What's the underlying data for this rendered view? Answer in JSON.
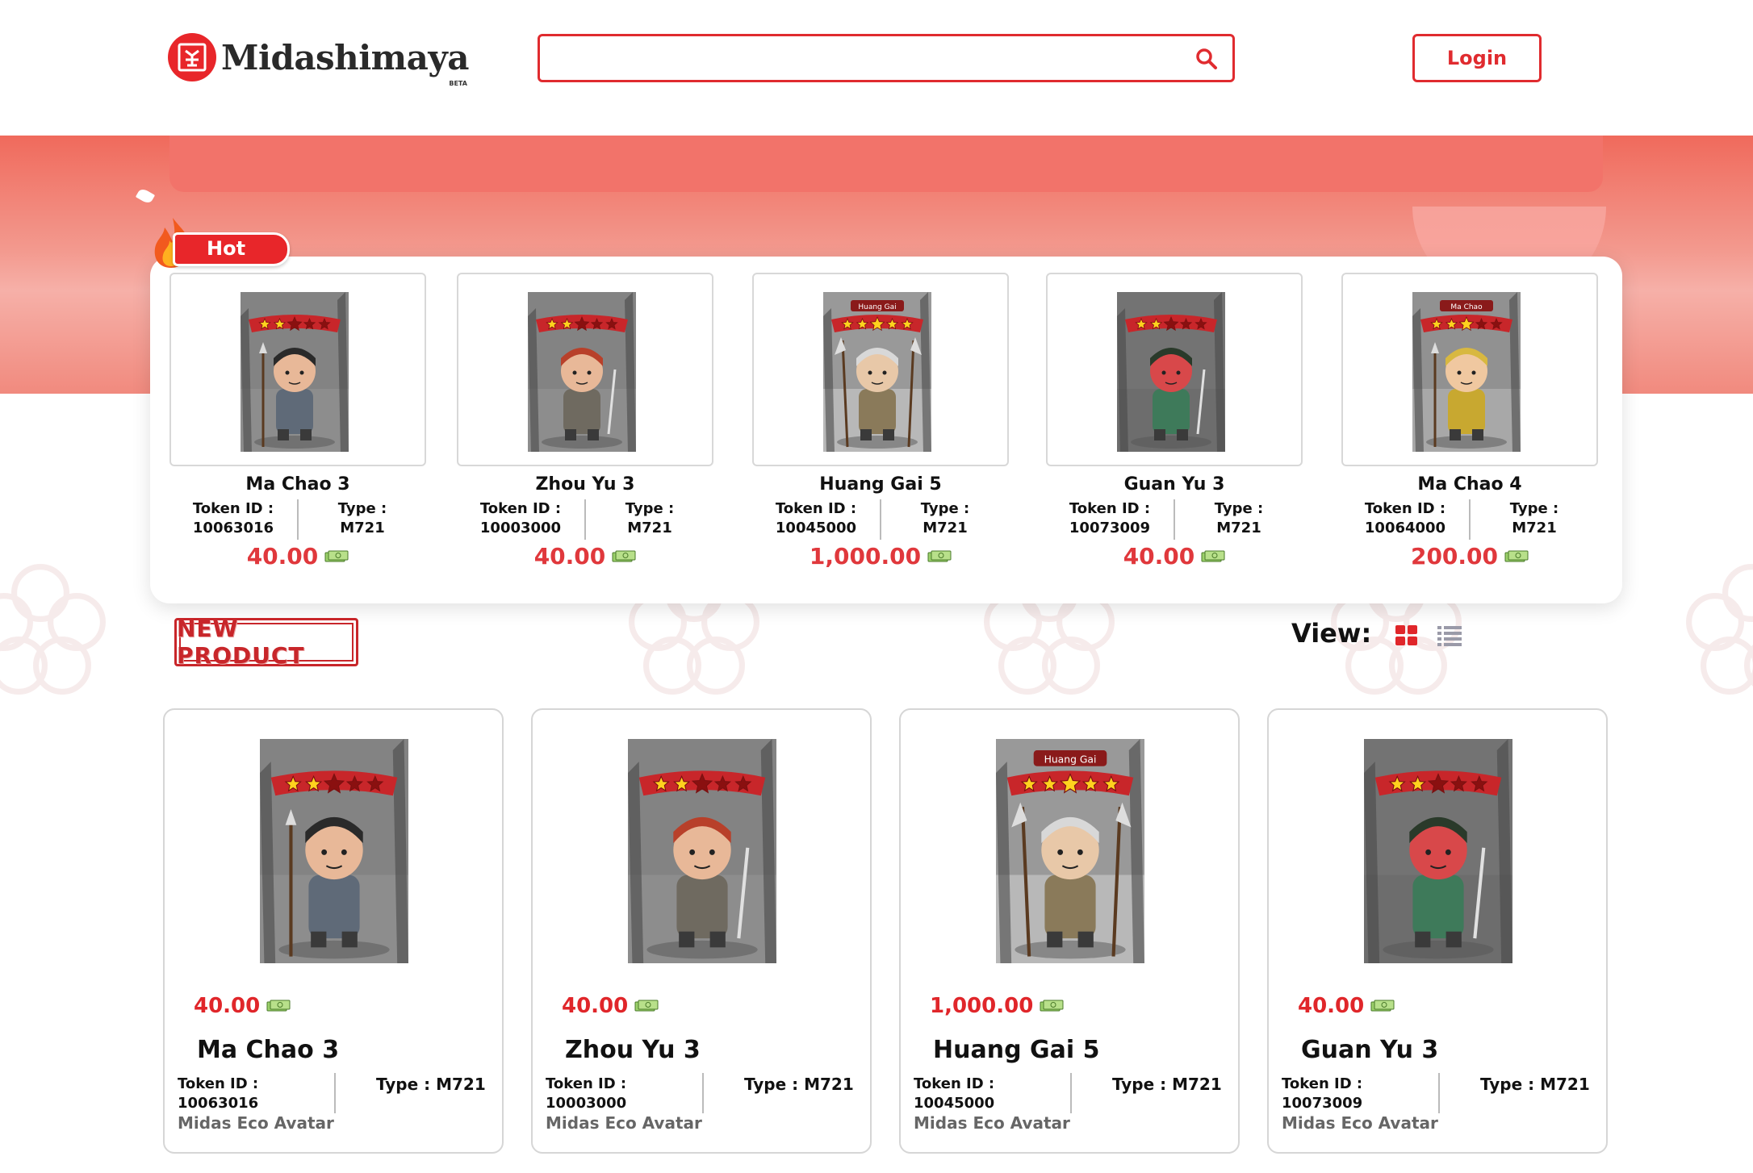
{
  "header": {
    "logo_text": "Midashimaya",
    "logo_badge": "BETA",
    "search": {
      "value": "",
      "placeholder": ""
    },
    "login_label": "Login"
  },
  "hot": {
    "badge": "Hot",
    "items": [
      {
        "name": "Ma Chao 3",
        "token_label": "Token ID :",
        "token_id": "10063016",
        "type_label": "Type :",
        "type": "M721",
        "price": "40.00"
      },
      {
        "name": "Zhou Yu 3",
        "token_label": "Token ID :",
        "token_id": "10003000",
        "type_label": "Type :",
        "type": "M721",
        "price": "40.00"
      },
      {
        "name": "Huang Gai 5",
        "token_label": "Token ID :",
        "token_id": "10045000",
        "type_label": "Type :",
        "type": "M721",
        "price": "1,000.00"
      },
      {
        "name": "Guan Yu 3",
        "token_label": "Token ID :",
        "token_id": "10073009",
        "type_label": "Type :",
        "type": "M721",
        "price": "40.00"
      },
      {
        "name": "Ma Chao 4",
        "token_label": "Token ID :",
        "token_id": "10064000",
        "type_label": "Type :",
        "type": "M721",
        "price": "200.00"
      }
    ]
  },
  "new_product": {
    "label": "NEW PRODUCT",
    "view_label": "View:",
    "products": [
      {
        "price": "40.00",
        "name": "Ma Chao 3",
        "token_label": "Token ID :",
        "token_id": "10063016",
        "type": "Type : M721",
        "collection": "Midas Eco Avatar"
      },
      {
        "price": "40.00",
        "name": "Zhou Yu 3",
        "token_label": "Token ID :",
        "token_id": "10003000",
        "type": "Type : M721",
        "collection": "Midas Eco Avatar"
      },
      {
        "price": "1,000.00",
        "name": "Huang Gai 5",
        "token_label": "Token ID :",
        "token_id": "10045000",
        "type": "Type : M721",
        "collection": "Midas Eco Avatar"
      },
      {
        "price": "40.00",
        "name": "Guan Yu 3",
        "token_label": "Token ID :",
        "token_id": "10073009",
        "type": "Type : M721",
        "collection": "Midas Eco Avatar"
      }
    ]
  },
  "colors": {
    "brand_red": "#e02b2f",
    "price_red": "#e0383c",
    "banner_coral": "#f2736a"
  },
  "icons": [
    "search-icon",
    "fire-icon",
    "money-icon",
    "grid-view-icon",
    "list-view-icon"
  ],
  "art_labels": {
    "huang_gai": "Huang Gai",
    "ma_chao": "Ma Chao"
  }
}
